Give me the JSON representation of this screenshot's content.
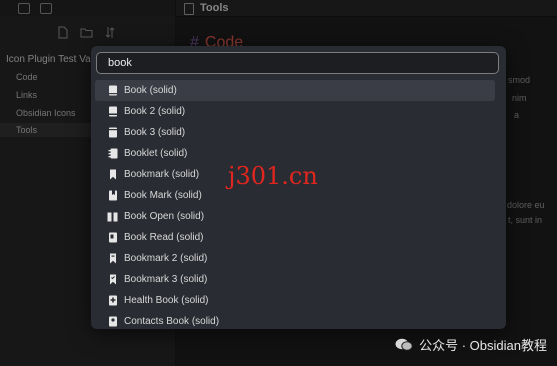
{
  "sidebar": {
    "vault_name": "Icon Plugin Test Va...",
    "items": [
      {
        "label": "Code"
      },
      {
        "label": "Links"
      },
      {
        "label": "Obsidian Icons"
      },
      {
        "label": "Tools"
      }
    ]
  },
  "tab": {
    "title": "Tools"
  },
  "editor": {
    "heading": "Code",
    "fragments": [
      "smod",
      "nim",
      "a",
      "dolore eu",
      "t, sunt in"
    ]
  },
  "search": {
    "value": "book",
    "placeholder": ""
  },
  "results": [
    {
      "label": "Book (solid)",
      "icon": "book-solid-icon"
    },
    {
      "label": "Book 2 (solid)",
      "icon": "book-2-solid-icon"
    },
    {
      "label": "Book 3 (solid)",
      "icon": "book-3-solid-icon"
    },
    {
      "label": "Booklet (solid)",
      "icon": "booklet-solid-icon"
    },
    {
      "label": "Bookmark (solid)",
      "icon": "bookmark-solid-icon"
    },
    {
      "label": "Book Mark (solid)",
      "icon": "book-mark-solid-icon"
    },
    {
      "label": "Book Open (solid)",
      "icon": "book-open-solid-icon"
    },
    {
      "label": "Book Read (solid)",
      "icon": "book-read-solid-icon"
    },
    {
      "label": "Bookmark 2 (solid)",
      "icon": "bookmark-2-solid-icon"
    },
    {
      "label": "Bookmark 3 (solid)",
      "icon": "bookmark-3-solid-icon"
    },
    {
      "label": "Health Book (solid)",
      "icon": "health-book-solid-icon"
    },
    {
      "label": "Contacts Book (solid)",
      "icon": "contacts-book-solid-icon"
    }
  ],
  "selected_index": 0,
  "watermark": {
    "center": "j301.cn",
    "footer": "公众号 · Obsidian教程"
  },
  "colors": {
    "accent_heading": "#e05a4e",
    "watermark_red": "#e0261f",
    "modal_bg": "#2a2c33"
  }
}
